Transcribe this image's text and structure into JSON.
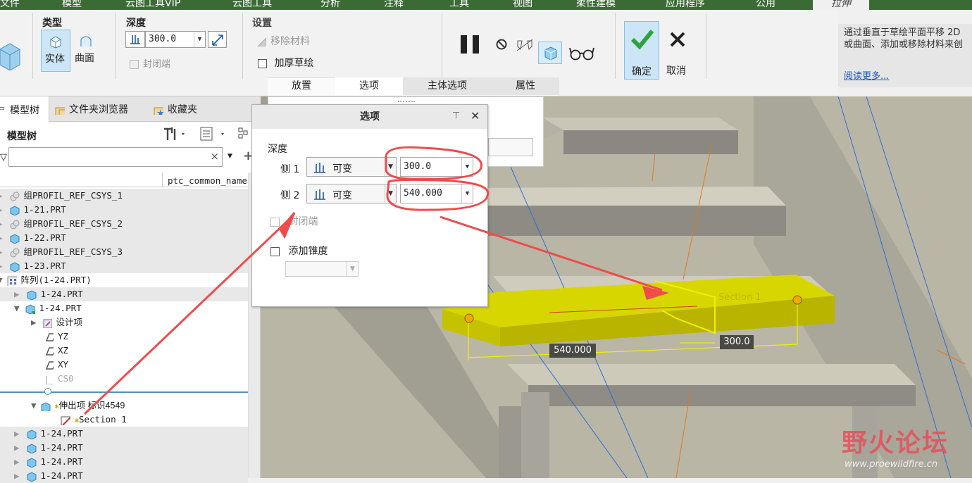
{
  "menubar": {
    "tabs": [
      "文件",
      "模型",
      "云图工具VIP",
      "云图工具",
      "分析",
      "注释",
      "工具",
      "视图",
      "柔性建模",
      "应用程序",
      "公用"
    ],
    "active_tab": "拉伸"
  },
  "ribbon": {
    "type": {
      "title": "类型",
      "solid": "实体",
      "surface": "曲面"
    },
    "depth": {
      "title": "深度",
      "value": "300.0",
      "capped_ends": "封闭端"
    },
    "settings": {
      "title": "设置",
      "remove_material": "移除材料",
      "thicken_sketch": "加厚草绘"
    },
    "ok": "确定",
    "cancel": "取消",
    "subtabs": [
      "放置",
      "选项",
      "主体选项",
      "属性"
    ]
  },
  "help": {
    "text": "通过垂直于草绘平面平移 2D 或曲面、添加或移除材料来创",
    "link": "阅读更多..."
  },
  "left_panel": {
    "tabs": [
      "模型树",
      "文件夹浏览器",
      "收藏夹"
    ],
    "header": "模型树",
    "filter_placeholder": "",
    "column": "ptc_common_name",
    "rows": [
      {
        "label": "组PROFIL_REF_CSYS_1",
        "icon": "group-icon"
      },
      {
        "label": "1-21.PRT",
        "icon": "part-icon"
      },
      {
        "label": "组PROFIL_REF_CSYS_2",
        "icon": "group-icon"
      },
      {
        "label": "1-22.PRT",
        "icon": "part-icon"
      },
      {
        "label": "组PROFIL_REF_CSYS_3",
        "icon": "group-icon"
      },
      {
        "label": "1-23.PRT",
        "icon": "part-icon"
      },
      {
        "label": "阵列(1-24.PRT)",
        "icon": "pattern-icon"
      },
      {
        "label": "1-24.PRT",
        "icon": "part-icon"
      },
      {
        "label": "1-24.PRT",
        "icon": "part-icon"
      },
      {
        "label": "设计项",
        "icon": "design-items-icon"
      },
      {
        "label": "YZ",
        "icon": "datum-plane-icon"
      },
      {
        "label": "XZ",
        "icon": "datum-plane-icon"
      },
      {
        "label": "XY",
        "icon": "datum-plane-icon"
      },
      {
        "label": "CS0",
        "icon": "csys-icon"
      },
      {
        "label": "伸出项 标识4549",
        "icon": "extrude-icon"
      },
      {
        "label": "Section 1",
        "icon": "sketch-icon"
      },
      {
        "label": "1-24.PRT",
        "icon": "part-icon"
      },
      {
        "label": "1-24.PRT",
        "icon": "part-icon"
      },
      {
        "label": "1-24.PRT",
        "icon": "part-icon"
      },
      {
        "label": "1-24.PRT",
        "icon": "part-icon"
      }
    ]
  },
  "dialog": {
    "title": "选项",
    "depth_label": "深度",
    "side1_label": "侧 1",
    "side1_mode": "可变",
    "side1_value": "300.0",
    "side2_label": "侧 2",
    "side2_mode": "可变",
    "side2_value": "540.000",
    "capped_ends": "封闭端",
    "add_taper": "添加锥度"
  },
  "viewport": {
    "dim_540": "540.000",
    "dim_300": "300.0",
    "section_label": "Section 1"
  },
  "watermark": {
    "title": "野火论坛",
    "url": "www.proewildfire.cn"
  }
}
